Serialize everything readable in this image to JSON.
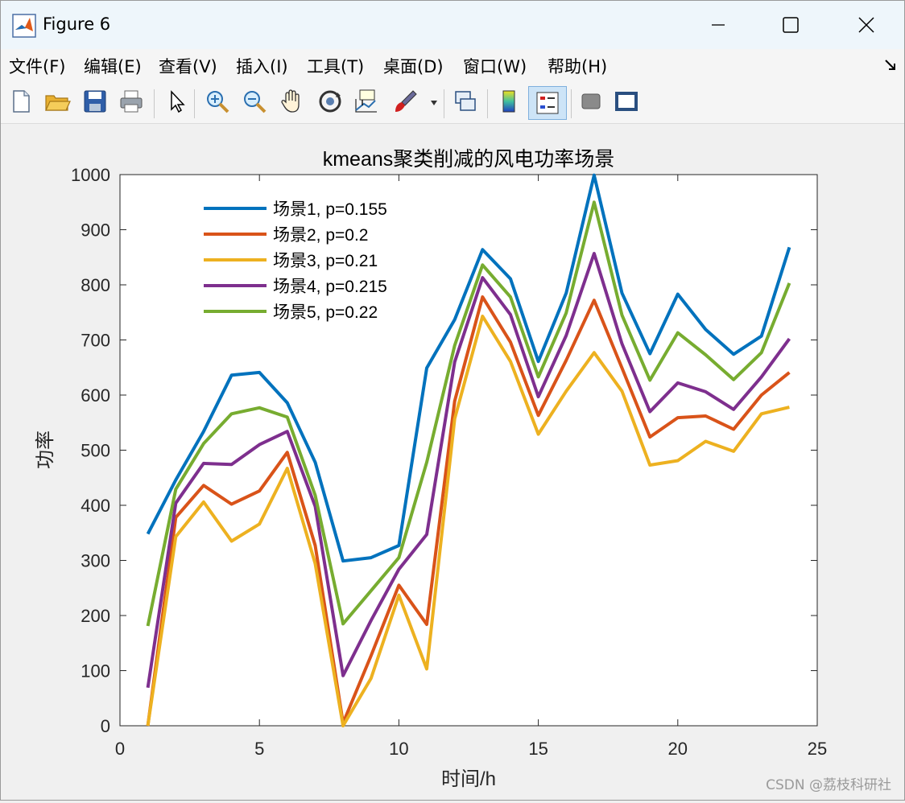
{
  "window": {
    "title": "Figure 6",
    "menu": [
      "文件(F)",
      "编辑(E)",
      "查看(V)",
      "插入(I)",
      "工具(T)",
      "桌面(D)",
      "窗口(W)",
      "帮助(H)"
    ],
    "toolbar_icons": [
      "new-file-icon",
      "open-folder-icon",
      "save-icon",
      "print-icon",
      "pointer-icon",
      "zoom-in-icon",
      "zoom-out-icon",
      "pan-hand-icon",
      "rotate-3d-icon",
      "data-cursor-icon",
      "brush-icon",
      "link-plot-icon",
      "colorbar-icon",
      "legend-icon",
      "hide-plot-tools-icon",
      "show-plot-tools-icon"
    ]
  },
  "watermark": "CSDN @荔枝科研社",
  "chart_data": {
    "type": "line",
    "title": "kmeans聚类削减的风电功率场景",
    "xlabel": "时间/h",
    "ylabel": "功率",
    "xlim": [
      0,
      25
    ],
    "ylim": [
      0,
      1000
    ],
    "xticks": [
      0,
      5,
      10,
      15,
      20,
      25
    ],
    "yticks": [
      0,
      100,
      200,
      300,
      400,
      500,
      600,
      700,
      800,
      900,
      1000
    ],
    "legend_position": "top-left",
    "grid": false,
    "x": [
      1,
      2,
      3,
      4,
      5,
      6,
      7,
      8,
      9,
      10,
      11,
      12,
      13,
      14,
      15,
      16,
      17,
      18,
      19,
      20,
      21,
      22,
      23,
      24
    ],
    "series": [
      {
        "name": "场景1, p=0.155",
        "color": "#0072BD",
        "values": [
          348,
          446,
          534,
          636,
          641,
          586,
          478,
          299,
          305,
          327,
          649,
          737,
          864,
          811,
          661,
          785,
          999,
          785,
          675,
          783,
          719,
          674,
          707,
          868
        ]
      },
      {
        "name": "场景2, p=0.2",
        "color": "#D95319",
        "values": [
          0,
          378,
          436,
          402,
          426,
          496,
          327,
          5,
          127,
          255,
          184,
          589,
          778,
          696,
          563,
          663,
          772,
          649,
          524,
          559,
          562,
          538,
          600,
          641
        ]
      },
      {
        "name": "场景3, p=0.21",
        "color": "#EDB120",
        "values": [
          0,
          343,
          406,
          335,
          366,
          467,
          294,
          0,
          86,
          237,
          103,
          557,
          743,
          661,
          529,
          607,
          677,
          607,
          473,
          481,
          516,
          498,
          566,
          578
        ]
      },
      {
        "name": "场景4, p=0.215",
        "color": "#7E2F8E",
        "values": [
          69,
          404,
          476,
          474,
          510,
          534,
          398,
          91,
          191,
          284,
          347,
          660,
          813,
          746,
          597,
          708,
          857,
          693,
          570,
          622,
          606,
          574,
          633,
          702
        ]
      },
      {
        "name": "场景5, p=0.22",
        "color": "#77AC30",
        "values": [
          181,
          429,
          512,
          566,
          577,
          560,
          418,
          185,
          245,
          305,
          478,
          690,
          836,
          778,
          633,
          749,
          950,
          745,
          627,
          713,
          673,
          628,
          677,
          803
        ]
      }
    ]
  }
}
